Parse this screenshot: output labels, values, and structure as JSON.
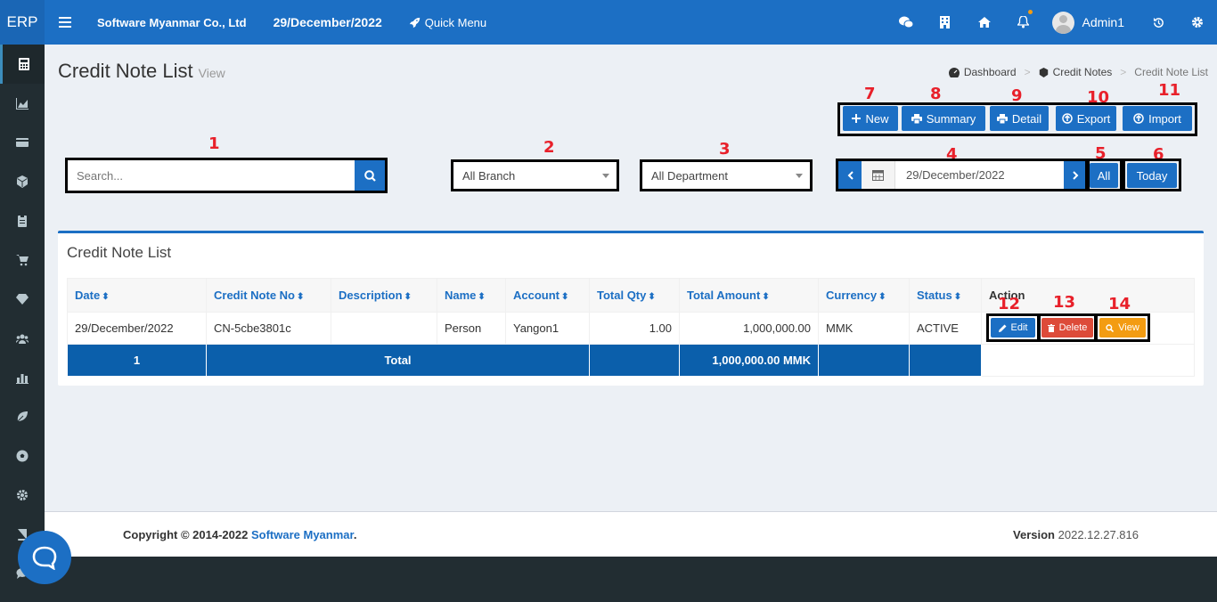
{
  "header": {
    "logo": "ERP",
    "company": "Software Myanmar Co., Ltd",
    "date": "29/December/2022",
    "quick_menu": "Quick Menu",
    "user": "Admin1",
    "icons": [
      "wechat-icon",
      "building-icon",
      "home-icon",
      "bell-icon",
      "history-icon",
      "gear-icon"
    ],
    "accent_color": "#1c6fc4"
  },
  "sidebar": {
    "items": [
      "calculator-icon",
      "area-chart-icon",
      "credit-card-icon",
      "cube-icon",
      "clipboard-icon",
      "cart-icon",
      "diamond-icon",
      "users-icon",
      "bar-chart-icon",
      "leaf-icon",
      "futbol-icon",
      "cog-icon",
      "book-icon",
      "comment-icon"
    ]
  },
  "page": {
    "title": "Credit Note List",
    "subtitle": "View"
  },
  "breadcrumb": {
    "dashboard": "Dashboard",
    "credit_notes": "Credit Notes",
    "current": "Credit Note List"
  },
  "toolbar": {
    "new": "New",
    "summary": "Summary",
    "detail": "Detail",
    "export": "Export",
    "import": "Import"
  },
  "filters": {
    "search_placeholder": "Search...",
    "branch": "All Branch",
    "department": "All Department",
    "date": "29/December/2022",
    "all": "All",
    "today": "Today"
  },
  "annotations": [
    "1",
    "2",
    "3",
    "4",
    "5",
    "6",
    "7",
    "8",
    "9",
    "10",
    "11",
    "12",
    "13",
    "14"
  ],
  "panel": {
    "title": "Credit Note List",
    "columns": [
      "Date",
      "Credit Note No",
      "Description",
      "Name",
      "Account",
      "Total Qty",
      "Total Amount",
      "Currency",
      "Status",
      "Action"
    ],
    "rows": [
      {
        "date": "29/December/2022",
        "no": "CN-5cbe3801c",
        "description": "",
        "name": "Person",
        "account": "Yangon1",
        "qty": "1.00",
        "amount": "1,000,000.00",
        "currency": "MMK",
        "status": "ACTIVE"
      }
    ],
    "total": {
      "count": "1",
      "label": "Total",
      "amount": "1,000,000.00 MMK"
    },
    "actions": {
      "edit": "Edit",
      "delete": "Delete",
      "view": "View"
    }
  },
  "footer": {
    "copyright": "Copyright © 2014-2022",
    "company_link": "Software Myanmar",
    "period": ".",
    "version_label": "Version",
    "version": "2022.12.27.816"
  }
}
